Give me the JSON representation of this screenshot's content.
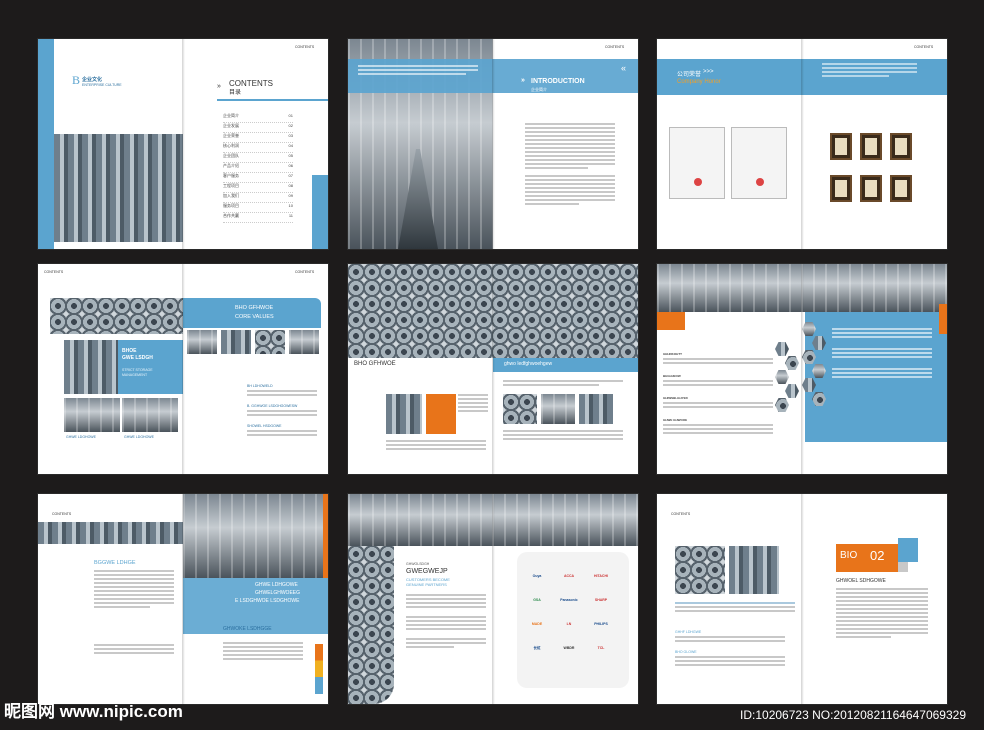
{
  "spread1": {
    "brand_b": "B",
    "brand_cn": "企业文化",
    "brand_en": "ENTERPRISE CULTURE",
    "contents_en": "CONTENTS",
    "contents_cn": "目录",
    "header": "CONTENTS",
    "toc": [
      {
        "label": "企业简介",
        "num": "01"
      },
      {
        "label": "企业发展",
        "num": "02"
      },
      {
        "label": "企业荣誉",
        "num": "03"
      },
      {
        "label": "核心利润",
        "num": "04"
      },
      {
        "label": "企业团队",
        "num": "05"
      },
      {
        "label": "产品介绍",
        "num": "06"
      },
      {
        "label": "客户服务",
        "num": "07"
      },
      {
        "label": "工程项目",
        "num": "08"
      },
      {
        "label": "加入我们",
        "num": "09"
      },
      {
        "label": "服务项目",
        "num": "10"
      },
      {
        "label": "合作共赢",
        "num": "11"
      }
    ]
  },
  "spread2": {
    "header": "CONTENTS",
    "title_en": "INTRODUCTION",
    "title_cn": "企业简介"
  },
  "spread3": {
    "header": "CONTENTS",
    "title_cn": "公司荣誉",
    "arrows": ">>>",
    "title_en": "Company Honor"
  },
  "spread4": {
    "header": "CONTENTS",
    "banner_1": "BHO GFHWOE",
    "banner_2": "CORE VALUES",
    "side_1": "BHOE",
    "side_2": "GWE LSDGH",
    "side_3": "STRICT STORAGE",
    "side_4": "MANAGEMENT",
    "item_1": "BH LDHOWELD",
    "item_2": "B. GGHWOE LSDGHGOWESW",
    "item_3": "SHOWEL HSDGOWE",
    "photo_cap_1": "GHWE LDGHOWE",
    "photo_cap_2": "GHWE LDGHOWE"
  },
  "spread5": {
    "bar_left": "BHO GFHWOE",
    "bar_right": "ghwo ledfghwoehgew"
  },
  "spread6": {
    "header": "CONTENTS",
    "heads": [
      "GEHDKOHTT",
      "BHGHJEOW",
      "GHIWSBLGHYED",
      "GHWE GHWOOE"
    ]
  },
  "spread7": {
    "header": "CONTENTS",
    "heading": "BGGWE LDHGE",
    "block_1": "GHWE LDHGOWE",
    "block_2": "GHWELGHWOEEG",
    "block_3": "E LSDGHWOE LSDGHOWE",
    "block_4": "GHWOKE LSDHGGE"
  },
  "spread8": {
    "small": "GHWOLSDGH",
    "heading": "GWEGWEJP",
    "sub_1": "CUSTOMERS BECOME",
    "sub_2": "GENUINE PARTNERS",
    "logos": [
      "Ouya",
      "ACCA",
      "HITACHI",
      "GSA",
      "Panasonic",
      "SHARP",
      "MADE",
      "LN",
      "PHILIPS",
      "长虹",
      "WBDR",
      "TCL"
    ]
  },
  "spread9": {
    "header": "CONTENTS",
    "bio": "BIO",
    "num": "02",
    "heading": "GHWOEL SDHGOWE",
    "item_1": "GHHF LDHGWE",
    "item_2": "BHO GLOWE"
  },
  "watermark": {
    "left": "昵图网 www.nipic.com",
    "right": "ID:10206723 NO:20120821164647069329"
  },
  "colors": {
    "accent_blue": "#5ba4cf",
    "accent_orange": "#e8741a",
    "background": "#1d1b1b"
  }
}
